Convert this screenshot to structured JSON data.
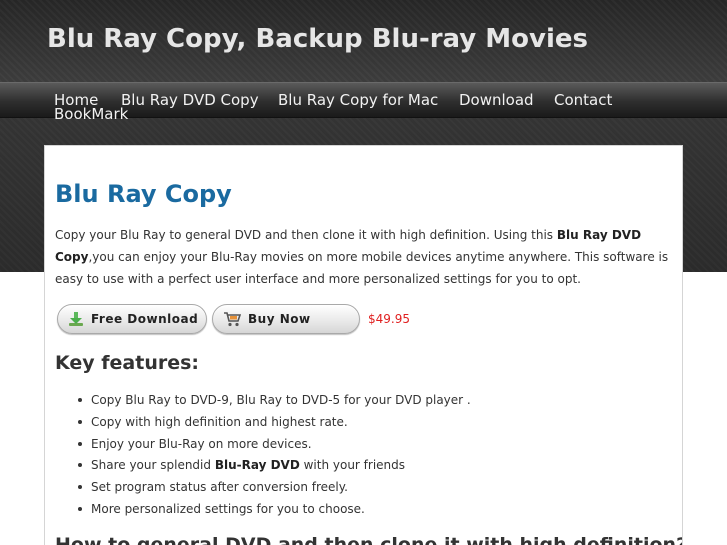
{
  "site": {
    "title": "Blu Ray Copy, Backup Blu-ray Movies"
  },
  "nav": {
    "items": [
      "Home",
      "Blu Ray DVD Copy",
      "Blu Ray Copy for Mac",
      "Download",
      "Contact",
      "BookMark"
    ]
  },
  "main": {
    "title": "Blu Ray Copy",
    "intro": {
      "part1": "Copy your Blu Ray to general DVD and then clone it with high definition. Using this ",
      "bold": "Blu Ray DVD Copy",
      "part2": ",you can enjoy your Blu-Ray movies on more mobile devices anytime anywhere. This software is easy to use with a perfect user interface and more personalized settings for you to opt."
    },
    "buttons": {
      "download_label": "Free Download",
      "buy_label": "Buy Now",
      "price": "$49.95"
    },
    "features_heading": "Key features:",
    "features": [
      {
        "text": "Copy Blu Ray to DVD-9, Blu Ray to DVD-5 for your DVD player ."
      },
      {
        "text": "Copy with high definition and highest rate."
      },
      {
        "text": "Enjoy your Blu-Ray on more devices."
      },
      {
        "pre": "Share your splendid ",
        "bold": "Blu-Ray DVD",
        "post": " with your friends"
      },
      {
        "text": "Set program status after conversion freely."
      },
      {
        "text": "More personalized settings for you to choose."
      }
    ],
    "how_heading": "How to general DVD and then clone it with high definition?"
  },
  "colors": {
    "title_blue": "#1a6aa0",
    "price_red": "#e02020",
    "header_dark": "#2b2b2b"
  }
}
